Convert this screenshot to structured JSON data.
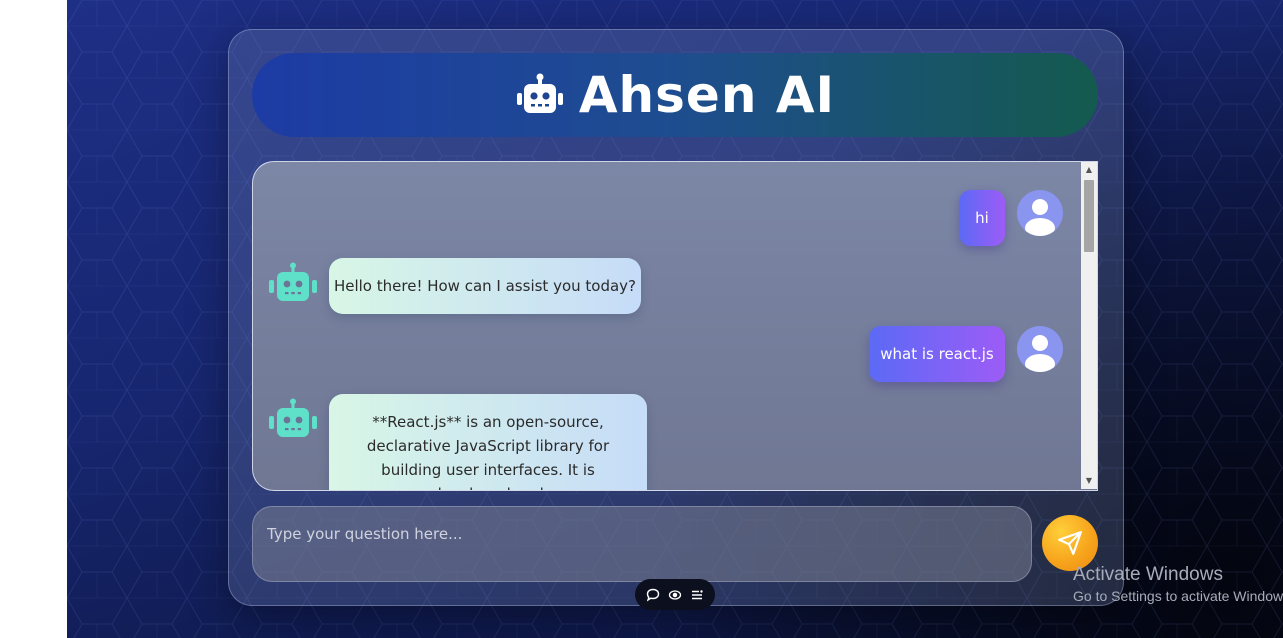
{
  "header": {
    "title": "Ahsen AI",
    "icon": "robot-icon"
  },
  "chat": {
    "messages": [
      {
        "role": "user",
        "text": "hi"
      },
      {
        "role": "bot",
        "text": "Hello there! How can I assist you today?"
      },
      {
        "role": "user",
        "text": "what is react.js"
      },
      {
        "role": "bot",
        "text": "**React.js** is an open-source, declarative JavaScript library for building user interfaces. It is developed and"
      }
    ]
  },
  "input": {
    "placeholder": "Type your question here...",
    "value": ""
  },
  "toolbar": {
    "icons": [
      "chat-bubble-icon",
      "eye-icon",
      "menu-list-icon"
    ]
  },
  "watermark": {
    "title": "Activate Windows",
    "subtitle": "Go to Settings to activate Windows."
  },
  "colors": {
    "header_start": "#1d3ba5",
    "header_end": "#145a4e",
    "user_bubble_start": "#5b6af5",
    "user_bubble_end": "#9d5cf6",
    "bot_bubble_start": "#d8f6e6",
    "bot_bubble_end": "#c6dcf8",
    "bot_icon": "#5fe0c8",
    "send_button": "#f7a51c"
  }
}
